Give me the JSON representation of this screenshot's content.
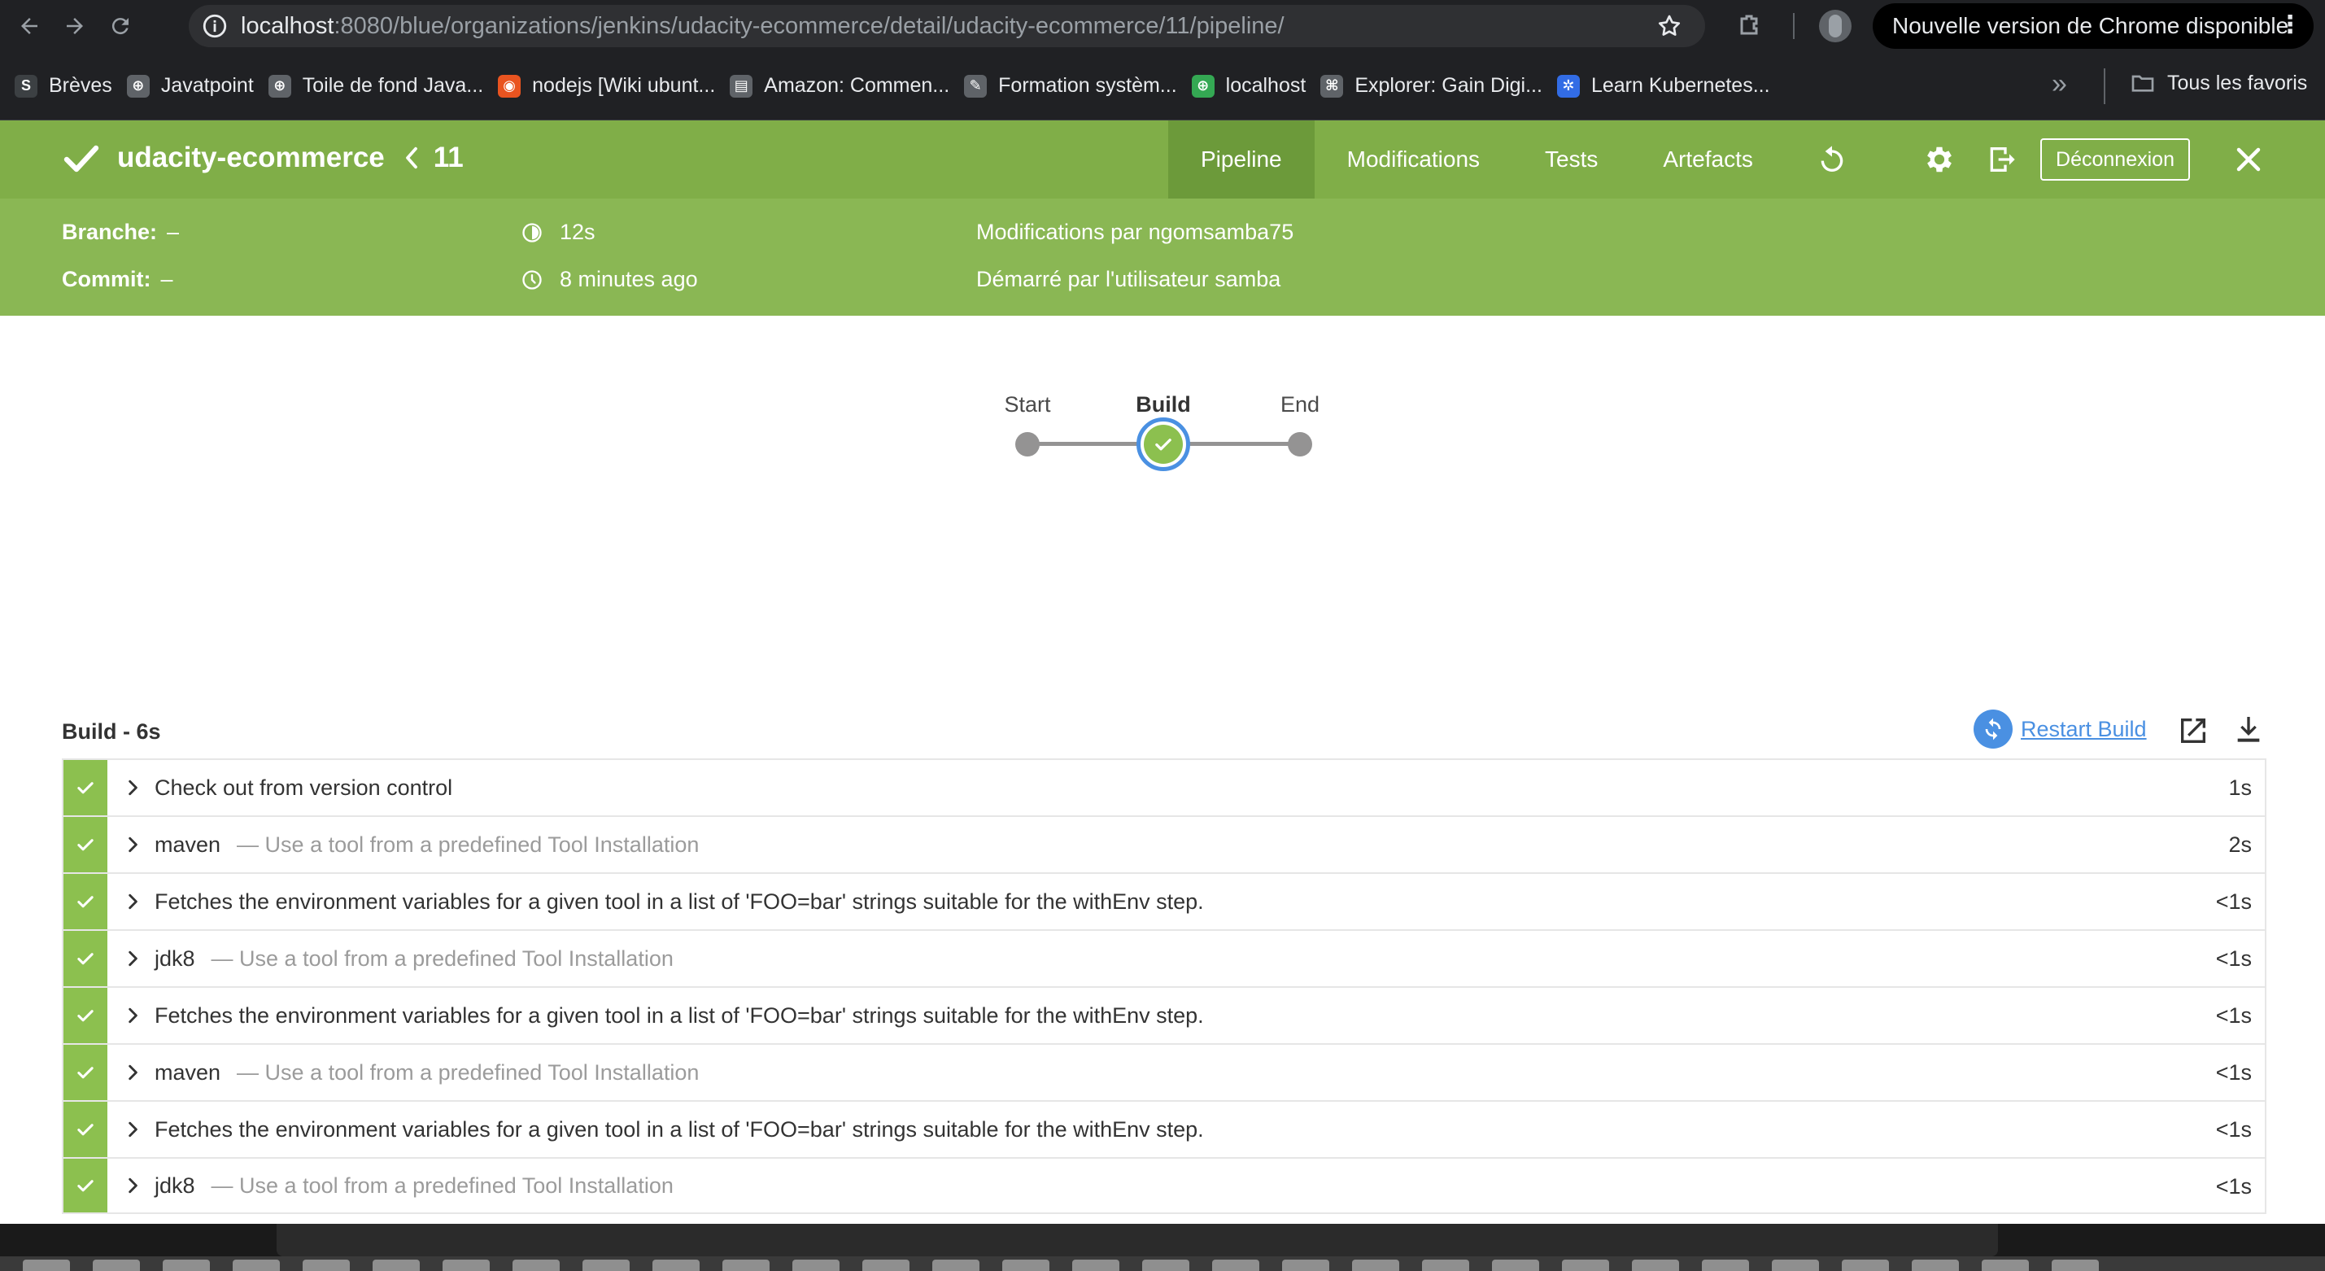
{
  "browser": {
    "url_host": "localhost",
    "url_rest": ":8080/blue/organizations/jenkins/udacity-ecommerce/detail/udacity-ecommerce/11/pipeline/",
    "update_notice": "Nouvelle version de Chrome disponible"
  },
  "bookmarks": {
    "items": [
      {
        "label": "Brèves",
        "icon": "s-letter-icon",
        "color": "#3c4043",
        "glyph": "S"
      },
      {
        "label": "Javatpoint",
        "icon": "globe-icon",
        "color": "#5f6368",
        "glyph": "⊕"
      },
      {
        "label": "Toile de fond Java...",
        "icon": "globe-icon",
        "color": "#5f6368",
        "glyph": "⊕"
      },
      {
        "label": "nodejs [Wiki ubunt...",
        "icon": "ubuntu-icon",
        "color": "#e95420",
        "glyph": "◉"
      },
      {
        "label": "Amazon: Commen...",
        "icon": "document-icon",
        "color": "#5f6368",
        "glyph": "▤"
      },
      {
        "label": "Formation systèm...",
        "icon": "tool-icon",
        "color": "#5f6368",
        "glyph": "✎"
      },
      {
        "label": "localhost",
        "icon": "green-globe-icon",
        "color": "#34a853",
        "glyph": "⊕"
      },
      {
        "label": "Explorer: Gain Digi...",
        "icon": "puzzle-icon",
        "color": "#5f6368",
        "glyph": "⌘"
      },
      {
        "label": "Learn Kubernetes...",
        "icon": "kubernetes-icon",
        "color": "#326ce5",
        "glyph": "✲"
      }
    ],
    "all_label": "Tous les favoris"
  },
  "header": {
    "pipeline_name": "udacity-ecommerce",
    "run_number": "11",
    "tabs": [
      {
        "label": "Pipeline",
        "active": true
      },
      {
        "label": "Modifications",
        "active": false
      },
      {
        "label": "Tests",
        "active": false
      },
      {
        "label": "Artefacts",
        "active": false
      }
    ],
    "logout_label": "Déconnexion"
  },
  "info": {
    "branch_label": "Branche:",
    "branch_value": "–",
    "commit_label": "Commit:",
    "commit_value": "–",
    "duration": "12s",
    "started": "8 minutes ago",
    "changes": "Modifications par ngomsamba75",
    "started_by": "Démarré par l'utilisateur samba"
  },
  "graph": {
    "stages": [
      {
        "label": "Start",
        "active": false
      },
      {
        "label": "Build",
        "active": true
      },
      {
        "label": "End",
        "active": false
      }
    ]
  },
  "steps_panel": {
    "title": "Build - 6s",
    "restart_label": "Restart Build",
    "steps": [
      {
        "label": "Check out from version control",
        "desc": "",
        "duration": "1s"
      },
      {
        "label": "maven",
        "desc": "— Use a tool from a predefined Tool Installation",
        "duration": "2s"
      },
      {
        "label": "Fetches the environment variables for a given tool in a list of 'FOO=bar' strings suitable for the withEnv step.",
        "desc": "",
        "duration": "<1s"
      },
      {
        "label": "jdk8",
        "desc": "— Use a tool from a predefined Tool Installation",
        "duration": "<1s"
      },
      {
        "label": "Fetches the environment variables for a given tool in a list of 'FOO=bar' strings suitable for the withEnv step.",
        "desc": "",
        "duration": "<1s"
      },
      {
        "label": "maven",
        "desc": "— Use a tool from a predefined Tool Installation",
        "duration": "<1s"
      },
      {
        "label": "Fetches the environment variables for a given tool in a list of 'FOO=bar' strings suitable for the withEnv step.",
        "desc": "",
        "duration": "<1s"
      },
      {
        "label": "jdk8",
        "desc": "— Use a tool from a predefined Tool Installation",
        "duration": "<1s"
      }
    ]
  },
  "colors": {
    "header_green": "#80ae48",
    "info_green": "#8ab754",
    "success": "#8cc04f",
    "link_blue": "#4a90e2"
  }
}
